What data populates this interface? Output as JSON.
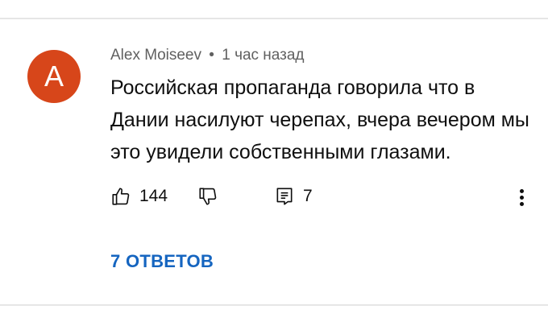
{
  "comment": {
    "avatar_letter": "A",
    "avatar_color": "#d7461a",
    "author": "Alex Moiseev",
    "separator": "•",
    "time": "1 час назад",
    "text": "Российская пропаганда говорила что в Дании насилуют черепах, вчера вечером мы это увидели собственными глазами."
  },
  "actions": {
    "like_icon": "thumbs-up-icon",
    "like_count": "144",
    "dislike_icon": "thumbs-down-icon",
    "reply_icon": "comment-icon",
    "reply_count": "7",
    "more_icon": "more-vertical-icon"
  },
  "replies": {
    "label": "7 ОТВЕТОВ",
    "link_color": "#1565c0"
  }
}
